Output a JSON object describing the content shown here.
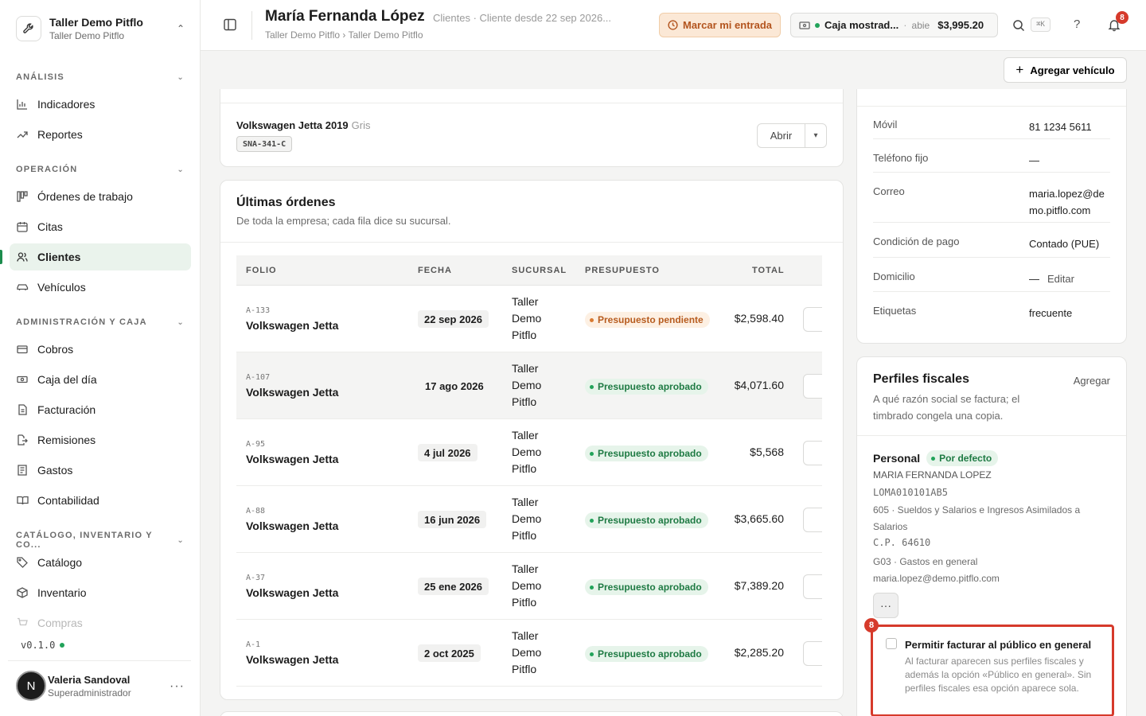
{
  "workspace": {
    "name": "Taller Demo Pitflo",
    "subtitle": "Taller Demo Pitflo"
  },
  "nav": {
    "sections": [
      {
        "label": "ANÁLISIS"
      },
      {
        "label": "OPERACIÓN"
      },
      {
        "label": "ADMINISTRACIÓN Y CAJA"
      },
      {
        "label": "CATÁLOGO, INVENTARIO Y CO..."
      }
    ],
    "items": [
      {
        "label": "Indicadores"
      },
      {
        "label": "Reportes"
      },
      {
        "label": "Órdenes de trabajo"
      },
      {
        "label": "Citas"
      },
      {
        "label": "Clientes"
      },
      {
        "label": "Vehículos"
      },
      {
        "label": "Cobros"
      },
      {
        "label": "Caja del día"
      },
      {
        "label": "Facturación"
      },
      {
        "label": "Remisiones"
      },
      {
        "label": "Gastos"
      },
      {
        "label": "Contabilidad"
      },
      {
        "label": "Catálogo"
      },
      {
        "label": "Inventario"
      },
      {
        "label": "Compras"
      }
    ],
    "version": "v0.1.0"
  },
  "user": {
    "initial": "N",
    "name": "Valeria Sandoval",
    "role": "Superadministrador"
  },
  "header": {
    "title": "María Fernanda López",
    "meta": "Clientes · Cliente desde 22 sep 2026...",
    "breadcrumb": "Taller Demo Pitflo › Taller Demo Pitflo",
    "clock_in_label": "Marcar mi entrada",
    "register": {
      "name": "Caja mostrad...",
      "sep": "·",
      "state": "abie",
      "amount": "$3,995.20"
    },
    "shortcut": "⌘K",
    "help": "?",
    "notifications": "8"
  },
  "subbar": {
    "add_vehicle_label": "Agregar vehículo"
  },
  "vehicle": {
    "name": "Volkswagen Jetta 2019",
    "color": "Gris",
    "plate": "SNA-341-C",
    "open_label": "Abrir"
  },
  "orders": {
    "title": "Últimas órdenes",
    "subtitle": "De toda la empresa; cada fila dice su sucursal.",
    "columns": {
      "folio": "FOLIO",
      "fecha": "FECHA",
      "sucursal": "SUCURSAL",
      "presupuesto": "PRESUPUESTO",
      "total": "TOTAL"
    },
    "rows": [
      {
        "folio": "A-133",
        "vehicle": "Volkswagen Jetta",
        "date": "22 sep 2026",
        "branch": "Taller Demo Pitflo",
        "status": "Presupuesto pendiente",
        "total": "$2,598.40"
      },
      {
        "folio": "A-107",
        "vehicle": "Volkswagen Jetta",
        "date": "17 ago 2026",
        "branch": "Taller Demo Pitflo",
        "status": "Presupuesto aprobado",
        "total": "$4,071.60"
      },
      {
        "folio": "A-95",
        "vehicle": "Volkswagen Jetta",
        "date": "4 jul 2026",
        "branch": "Taller Demo Pitflo",
        "status": "Presupuesto aprobado",
        "total": "$5,568"
      },
      {
        "folio": "A-88",
        "vehicle": "Volkswagen Jetta",
        "date": "16 jun 2026",
        "branch": "Taller Demo Pitflo",
        "status": "Presupuesto aprobado",
        "total": "$3,665.60"
      },
      {
        "folio": "A-37",
        "vehicle": "Volkswagen Jetta",
        "date": "25 ene 2026",
        "branch": "Taller Demo Pitflo",
        "status": "Presupuesto aprobado",
        "total": "$7,389.20"
      },
      {
        "folio": "A-1",
        "vehicle": "Volkswagen Jetta",
        "date": "2 oct 2025",
        "branch": "Taller Demo Pitflo",
        "status": "Presupuesto aprobado",
        "total": "$2,285.20"
      }
    ]
  },
  "contact": {
    "rows": [
      {
        "label": "Móvil",
        "value": "81 1234 5611"
      },
      {
        "label": "Teléfono fijo",
        "value": "—"
      },
      {
        "label": "Correo",
        "value": "maria.lopez@demo.pitflo.com"
      },
      {
        "label": "Condición de pago",
        "value": "Contado (PUE)"
      },
      {
        "label": "Domicilio",
        "value": "—",
        "action": "Editar"
      },
      {
        "label": "Etiquetas",
        "value": "frecuente"
      }
    ]
  },
  "fiscal": {
    "title": "Perfiles fiscales",
    "subtitle": "A qué razón social se factura; el timbrado congela una copia.",
    "add_label": "Agregar",
    "profile": {
      "name": "Personal",
      "default_badge": "Por defecto",
      "legal_name": "MARIA FERNANDA LOPEZ",
      "rfc": "LOMA010101AB5",
      "regime": "605 · Sueldos y Salarios e Ingresos Asimilados a Salarios",
      "zip": "C.P. 64610",
      "cfdi_use": "G03 · Gastos en general",
      "email": "maria.lopez@demo.pitflo.com",
      "more": "···"
    },
    "public_invoice": {
      "marker": "8",
      "label": "Permitir facturar al público en general",
      "description": "Al facturar aparecen sus perfiles fiscales y además la opción «Público en general». Sin perfiles fiscales esa opción aparece sola."
    }
  },
  "colors": {
    "accent_green": "#22a35a",
    "alert_red": "#d63a2b",
    "warning_orange": "#b3541e"
  }
}
